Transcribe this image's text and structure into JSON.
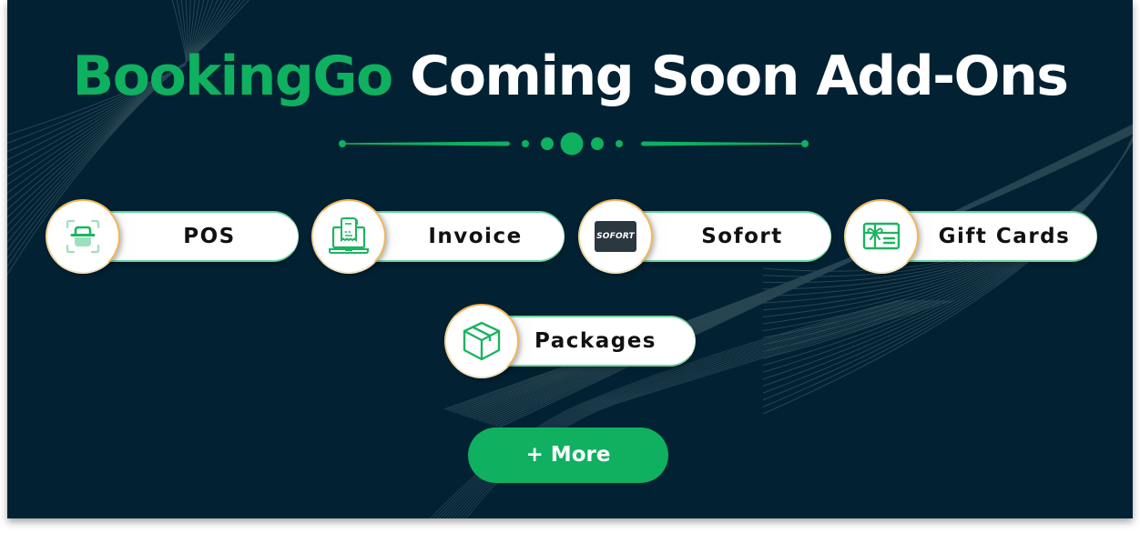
{
  "title": {
    "brand": "BookingGo",
    "rest": "Coming Soon Add-Ons"
  },
  "colors": {
    "background": "#022233",
    "accent": "#0fb060",
    "icon_green": "#1cb461",
    "circle_ring": "#f2b75a"
  },
  "addons": [
    {
      "label": "POS",
      "icon": "scanner-basket-icon"
    },
    {
      "label": "Invoice",
      "icon": "laptop-receipt-icon"
    },
    {
      "label": "Sofort",
      "icon": "sofort-logo",
      "logo_text": "SOFORT"
    },
    {
      "label": "Gift Cards",
      "icon": "gift-card-icon"
    },
    {
      "label": "Packages",
      "icon": "package-box-icon"
    }
  ],
  "more_button": {
    "label": "+ More"
  }
}
